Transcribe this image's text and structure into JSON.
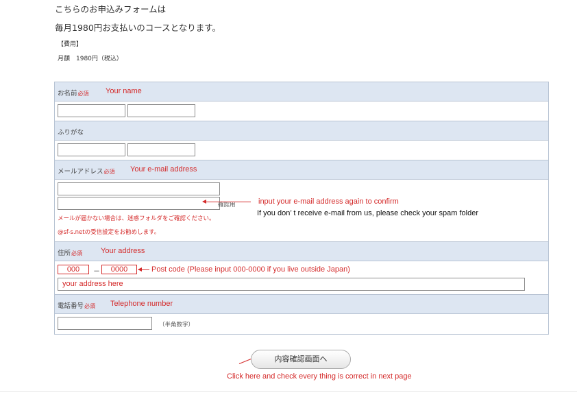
{
  "intro": {
    "line1": "こちらのお申込みフォームは",
    "line2": "毎月1980円お支払いのコースとなります。"
  },
  "fee": {
    "label": "【費用】",
    "value": "月額　1980円（税込）"
  },
  "name": {
    "label": "お名前",
    "required": "必須",
    "english": "Your name"
  },
  "furigana": {
    "label": "ふりがな"
  },
  "email": {
    "label": "メールアドレス",
    "required": "必須",
    "english": "Your e-mail address",
    "confirm_label": "確認用",
    "confirm_note": "input your e-mail address again to confirm",
    "spam_note_en": "If you don’ t receive e-mail from us, please check your spam folder",
    "warning1": "メールが届かない場合は、迷惑フォルダをご確認ください。",
    "warning2": "@sf-s.netの受信設定をお勧めします。"
  },
  "address": {
    "label": "住所",
    "required": "必須",
    "english": "Your address",
    "zip1": "000",
    "zip_sep": "－",
    "zip2": "0000",
    "zip_note": "Post code (Please input 000-0000 if you live outside Japan)",
    "address_value": "your address here"
  },
  "phone": {
    "label": "電話番号",
    "required": "必須",
    "english": "Telephone number",
    "hint": "（半角数字）"
  },
  "submit": {
    "label": "内容確認画面へ",
    "note": "Click here and check every thing is correct in next page"
  }
}
